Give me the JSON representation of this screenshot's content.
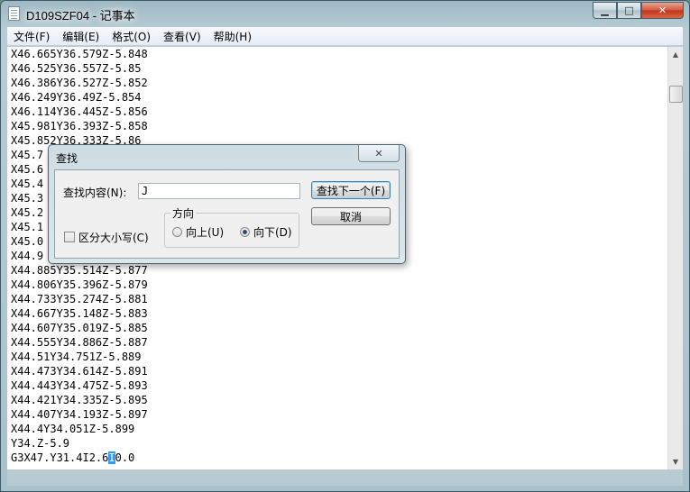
{
  "window": {
    "title": "D109SZF04 - 记事本",
    "minimize_glyph": "▁",
    "maximize_glyph": "□",
    "close_glyph": "✕"
  },
  "menu": [
    "文件(F)",
    "编辑(E)",
    "格式(O)",
    "查看(V)",
    "帮助(H)"
  ],
  "editor": {
    "lines": [
      "X46.665Y36.579Z-5.848",
      "X46.525Y36.557Z-5.85",
      "X46.386Y36.527Z-5.852",
      "X46.249Y36.49Z-5.854",
      "X46.114Y36.445Z-5.856",
      "X45.981Y36.393Z-5.858",
      "X45.852Y36.333Z-5.86",
      "X45.7",
      "X45.6",
      "X45.4",
      "X45.3",
      "X45.2",
      "X45.1",
      "X45.0",
      "X44.9",
      "X44.885Y35.514Z-5.877",
      "X44.806Y35.396Z-5.879",
      "X44.733Y35.274Z-5.881",
      "X44.667Y35.148Z-5.883",
      "X44.607Y35.019Z-5.885",
      "X44.555Y34.886Z-5.887",
      "X44.51Y34.751Z-5.889",
      "X44.473Y34.614Z-5.891",
      "X44.443Y34.475Z-5.893",
      "X44.421Y34.335Z-5.895",
      "X44.407Y34.193Z-5.897",
      "X44.4Y34.051Z-5.899",
      "Y34.Z-5.9"
    ],
    "last_line_before": "G3X47.Y31.4I2.6",
    "last_line_highlight": "I",
    "last_line_after": "0.0",
    "colors": {
      "selection": "#3399ff"
    }
  },
  "scrollbar": {
    "up_glyph": "▲",
    "down_glyph": "▼"
  },
  "find_dialog": {
    "title": "查找",
    "close_glyph": "✕",
    "find_label": "查找内容(N):",
    "find_value": "J",
    "find_next_label": "查找下一个(F)",
    "cancel_label": "取消",
    "direction_label": "方向",
    "up_label": "向上(U)",
    "down_label": "向下(D)",
    "selected_direction": "down",
    "match_case_label": "区分大小写(C)",
    "match_case_checked": false
  }
}
